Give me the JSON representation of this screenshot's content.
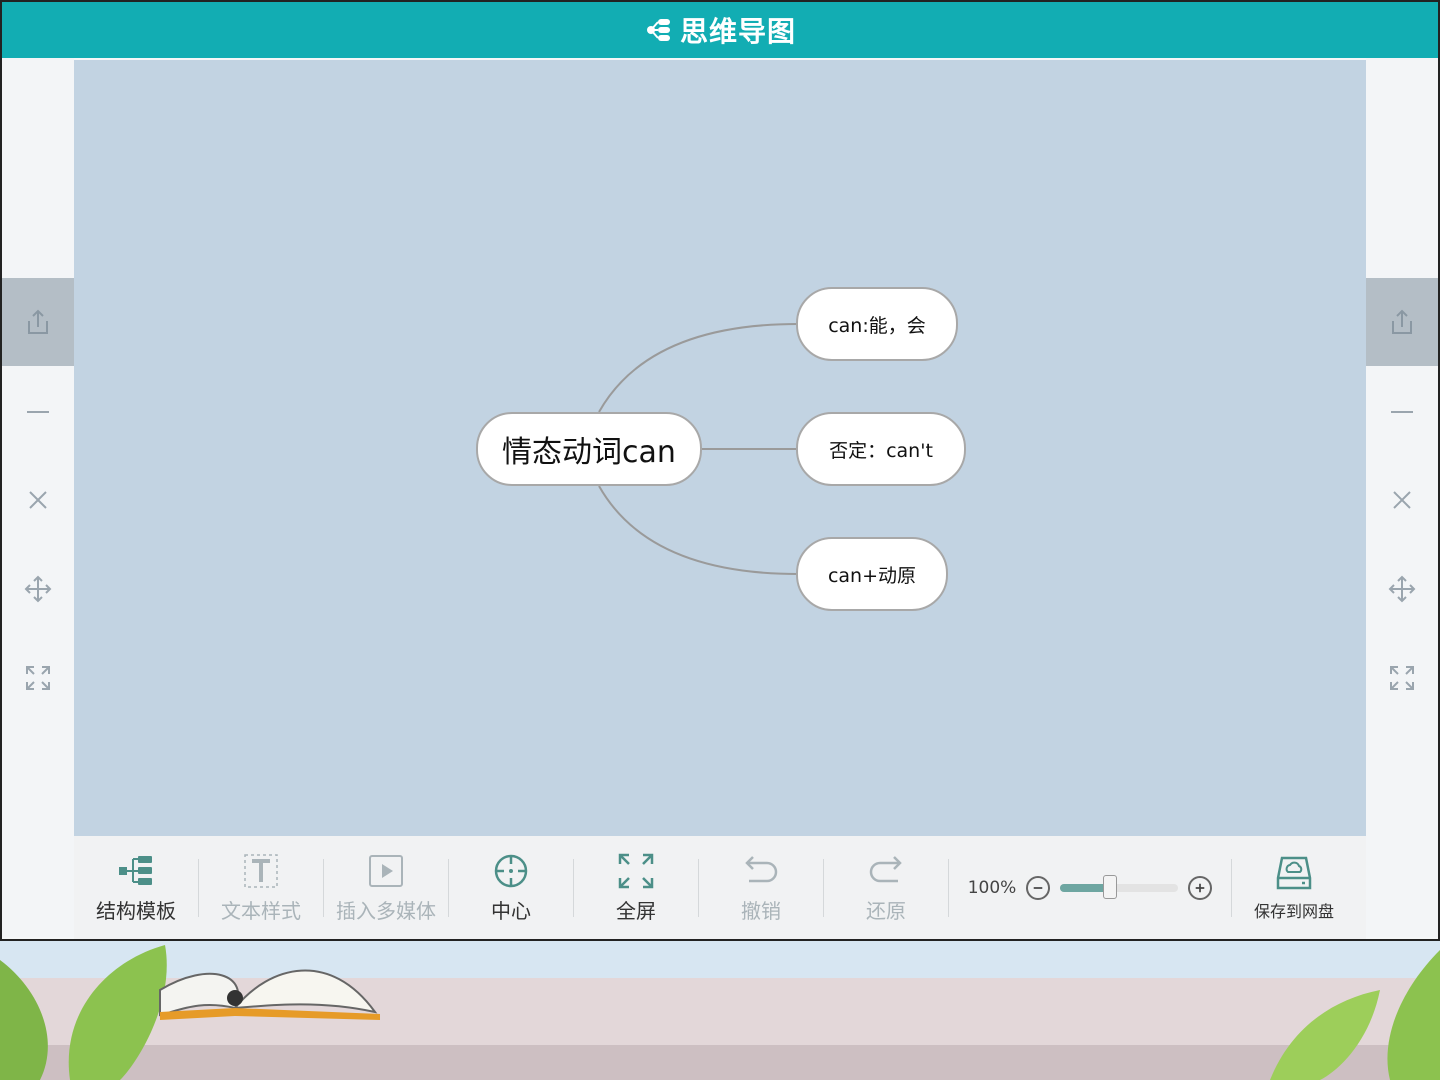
{
  "app": {
    "title": "思维导图"
  },
  "side_panel": {
    "items": [
      {
        "icon": "share-icon",
        "active": true
      },
      {
        "icon": "minus-icon"
      },
      {
        "icon": "close-icon"
      },
      {
        "icon": "move-icon"
      },
      {
        "icon": "expand-icon"
      }
    ]
  },
  "mindmap": {
    "root": {
      "label": "情态动词can"
    },
    "children": [
      {
        "label": "can:能，会"
      },
      {
        "label": "否定：can't"
      },
      {
        "label": "can+动原"
      }
    ],
    "link_color": "#9a9a9a",
    "canvas_color": "#c2d3e2"
  },
  "toolbar": {
    "structure_template": "结构模板",
    "text_style": "文本样式",
    "insert_media": "插入多媒体",
    "center": "中心",
    "fullscreen": "全屏",
    "undo": "撤销",
    "redo": "还原",
    "zoom_label": "100%",
    "zoom_level": 0.42,
    "save_to_cloud": "保存到网盘"
  },
  "colors": {
    "accent": "#12adb3"
  }
}
